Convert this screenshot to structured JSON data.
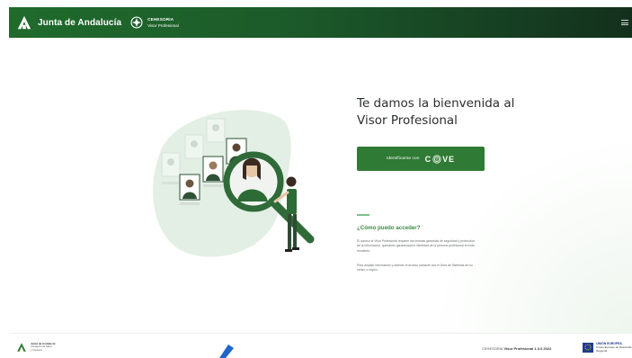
{
  "header": {
    "brand": "Junta de Andalucía",
    "subbrand_line1": "CEHESORIA",
    "subbrand_line2": "Visor Profesional",
    "colors": {
      "header_start": "#1f6b2c",
      "header_end": "#13301d"
    }
  },
  "main": {
    "welcome_line1": "Te damos la bienvenida al",
    "welcome_line2": "Visor Profesional",
    "id_button_label": "Identificarse con",
    "clave_c": "C",
    "clave_rest": "VE",
    "access_heading": "¿Cómo puedo acceder?",
    "access_p1": "El acceso al Visor Profesional requiere las mismas garantías de seguridad y protección de la información, quedando garantizada la identidad de la persona profesional en todo momento.",
    "access_p2": "Para ampliar información y obtener el acceso contacte con el Área de Sistemas de su centro o región.",
    "accent_color": "#2f7a34"
  },
  "footer": {
    "logo_line1": "Junta de Andalucía",
    "logo_line2": "Consejería de Salud",
    "logo_line3": "y Consumo",
    "version_text_prefix": "CEHESORIA",
    "version_text": "Visor Profesional 1.3.0 2022",
    "eu_line1": "UNIÓN EUROPEA",
    "eu_line2": "Fondo Europeo de Desarrollo Regional"
  },
  "icons": [
    "junta-a-logo-icon",
    "cehesoria-logo-icon",
    "menu-icon",
    "clave-fingerprint-icon",
    "eu-flag-icon"
  ]
}
